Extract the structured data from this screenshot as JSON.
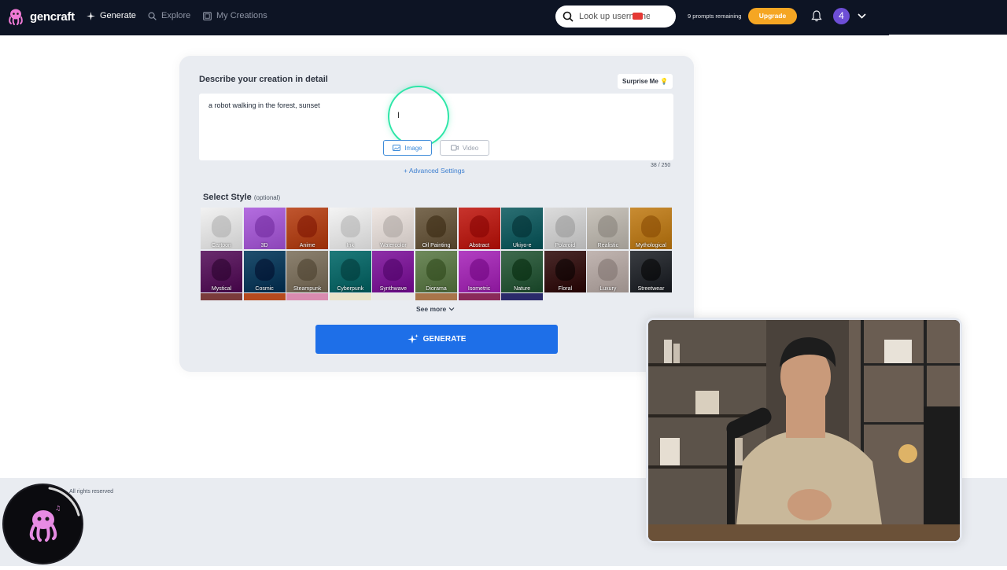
{
  "nav": {
    "brand": "gencraft",
    "links": [
      {
        "label": "Generate",
        "active": true
      },
      {
        "label": "Explore",
        "active": false
      },
      {
        "label": "My Creations",
        "active": false
      }
    ],
    "search_placeholder": "Look up usernames",
    "prompts_remaining": "9 prompts remaining",
    "upgrade_label": "Upgrade",
    "user_initial": "4",
    "accent_color": "#f5a623",
    "bg_color": "#0d1424"
  },
  "creator": {
    "describe_label": "Describe your creation in detail",
    "surprise_label": "Surprise Me",
    "prompt_text": "a robot walking in the forest, sunset",
    "modes": [
      {
        "label": "Image",
        "icon": "image-icon",
        "selected": true
      },
      {
        "label": "Video",
        "icon": "video-icon",
        "selected": false
      }
    ],
    "char_count": "38 / 250",
    "advanced_label": "+ Advanced Settings",
    "select_style_label": "Select Style",
    "optional_label": "(optional)",
    "styles": [
      {
        "name": "Cartoon",
        "color": "#f2f2f2"
      },
      {
        "name": "3D",
        "color": "#b46de0"
      },
      {
        "name": "Anime",
        "color": "#c0562f"
      },
      {
        "name": "Ink",
        "color": "#f4f4f4"
      },
      {
        "name": "Watercolor",
        "color": "#f0e8e4"
      },
      {
        "name": "Oil Painting",
        "color": "#7a6a52"
      },
      {
        "name": "Abstract",
        "color": "#c8342d"
      },
      {
        "name": "Ukiyo-e",
        "color": "#2b6f73"
      },
      {
        "name": "Polaroid",
        "color": "#dcdcdc"
      },
      {
        "name": "Realistic",
        "color": "#c9c4bc"
      },
      {
        "name": "Mythological",
        "color": "#c98c32"
      },
      {
        "name": "Mystical",
        "color": "#6a2c6e"
      },
      {
        "name": "Cosmic",
        "color": "#1f4f6e"
      },
      {
        "name": "Steampunk",
        "color": "#8d8270"
      },
      {
        "name": "Cyberpunk",
        "color": "#1e7a7a"
      },
      {
        "name": "Synthwave",
        "color": "#8e2fa8"
      },
      {
        "name": "Diorama",
        "color": "#6f8a5c"
      },
      {
        "name": "Isometric",
        "color": "#b23fc2"
      },
      {
        "name": "Nature",
        "color": "#3f6b4e"
      },
      {
        "name": "Floral",
        "color": "#4a2a2a"
      },
      {
        "name": "Luxury",
        "color": "#c2b6b2"
      },
      {
        "name": "Streetwear",
        "color": "#3a3d42"
      }
    ],
    "see_more_label": "See more",
    "generate_label": "GENERATE",
    "generate_color": "#1e6fe8"
  },
  "footer": {
    "rights_text": "All rights reserved"
  }
}
